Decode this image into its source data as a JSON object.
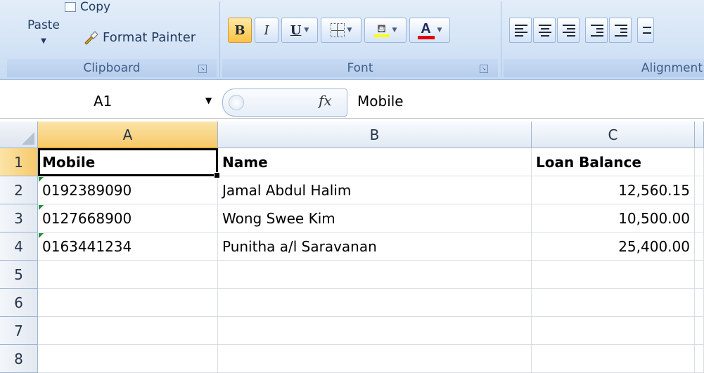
{
  "ribbon": {
    "clipboard": {
      "paste_label": "Paste",
      "copy_label": "Copy",
      "format_painter_label": "Format Painter",
      "group_label": "Clipboard"
    },
    "font": {
      "group_label": "Font",
      "bold_glyph": "B",
      "italic_glyph": "I",
      "underline_glyph": "U",
      "font_color_glyph": "A",
      "highlight_color": "#ffff00",
      "font_color": "#e00000"
    },
    "alignment": {
      "group_label": "Alignment"
    }
  },
  "formula_bar": {
    "name_box": "A1",
    "fx_label": "fx",
    "content": "Mobile"
  },
  "sheet": {
    "selected_cell": "A1",
    "columns": [
      "A",
      "B",
      "C"
    ],
    "rows": [
      {
        "num": "1",
        "cells": [
          "Mobile",
          "Name",
          "Loan Balance"
        ]
      },
      {
        "num": "2",
        "cells": [
          "0192389090",
          "Jamal Abdul Halim",
          "12,560.15"
        ]
      },
      {
        "num": "3",
        "cells": [
          "0127668900",
          "Wong Swee Kim",
          "10,500.00"
        ]
      },
      {
        "num": "4",
        "cells": [
          "0163441234",
          "Punitha a/l Saravanan",
          "25,400.00"
        ]
      },
      {
        "num": "5",
        "cells": [
          "",
          "",
          ""
        ]
      },
      {
        "num": "6",
        "cells": [
          "",
          "",
          ""
        ]
      },
      {
        "num": "7",
        "cells": [
          "",
          "",
          ""
        ]
      },
      {
        "num": "8",
        "cells": [
          "",
          "",
          ""
        ]
      }
    ]
  }
}
